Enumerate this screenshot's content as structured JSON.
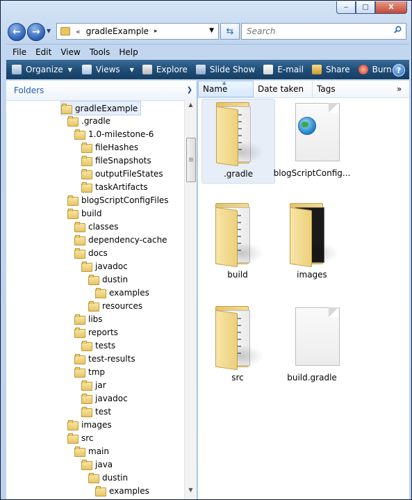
{
  "window": {
    "minimize_glyph": "‒",
    "maximize_glyph": "□",
    "close_glyph": "X"
  },
  "nav": {
    "back_glyph": "←",
    "forward_glyph": "→",
    "breadcrumb_chevron": "«",
    "path": "gradleExample",
    "path_separator": "▸",
    "search_placeholder": "Search"
  },
  "menu": [
    "File",
    "Edit",
    "View",
    "Tools",
    "Help"
  ],
  "toolbar": {
    "organize": "Organize",
    "views": "Views",
    "explore": "Explore",
    "slideshow": "Slide Show",
    "email": "E-mail",
    "share": "Share",
    "burn": "Burn",
    "help_glyph": "?"
  },
  "folders_pane": {
    "title": "Folders",
    "tree": [
      {
        "label": "gradleExample",
        "depth": 0,
        "selected": true
      },
      {
        "label": ".gradle",
        "depth": 1
      },
      {
        "label": "1.0-milestone-6",
        "depth": 2
      },
      {
        "label": "fileHashes",
        "depth": 3
      },
      {
        "label": "fileSnapshots",
        "depth": 3
      },
      {
        "label": "outputFileStates",
        "depth": 3
      },
      {
        "label": "taskArtifacts",
        "depth": 3
      },
      {
        "label": "blogScriptConfigFiles",
        "depth": 1
      },
      {
        "label": "build",
        "depth": 1
      },
      {
        "label": "classes",
        "depth": 2
      },
      {
        "label": "dependency-cache",
        "depth": 2
      },
      {
        "label": "docs",
        "depth": 2
      },
      {
        "label": "javadoc",
        "depth": 3
      },
      {
        "label": "dustin",
        "depth": 4
      },
      {
        "label": "examples",
        "depth": 5
      },
      {
        "label": "resources",
        "depth": 4
      },
      {
        "label": "libs",
        "depth": 2
      },
      {
        "label": "reports",
        "depth": 2
      },
      {
        "label": "tests",
        "depth": 3
      },
      {
        "label": "test-results",
        "depth": 2
      },
      {
        "label": "tmp",
        "depth": 2
      },
      {
        "label": "jar",
        "depth": 3
      },
      {
        "label": "javadoc",
        "depth": 3
      },
      {
        "label": "test",
        "depth": 3
      },
      {
        "label": "images",
        "depth": 1
      },
      {
        "label": "src",
        "depth": 1
      },
      {
        "label": "main",
        "depth": 2
      },
      {
        "label": "java",
        "depth": 3
      },
      {
        "label": "dustin",
        "depth": 4
      },
      {
        "label": "examples",
        "depth": 5
      }
    ]
  },
  "columns": {
    "name": "Name",
    "date_taken": "Date taken",
    "tags": "Tags",
    "more": "»"
  },
  "items": [
    {
      "label": ".gradle",
      "kind": "folder-docs",
      "selected": true
    },
    {
      "label": "blogScriptConfig...",
      "kind": "file-html"
    },
    {
      "label": "build",
      "kind": "folder-docs"
    },
    {
      "label": "images",
      "kind": "folder-images"
    },
    {
      "label": "src",
      "kind": "folder-docs"
    },
    {
      "label": "build.gradle",
      "kind": "file-blank"
    }
  ]
}
